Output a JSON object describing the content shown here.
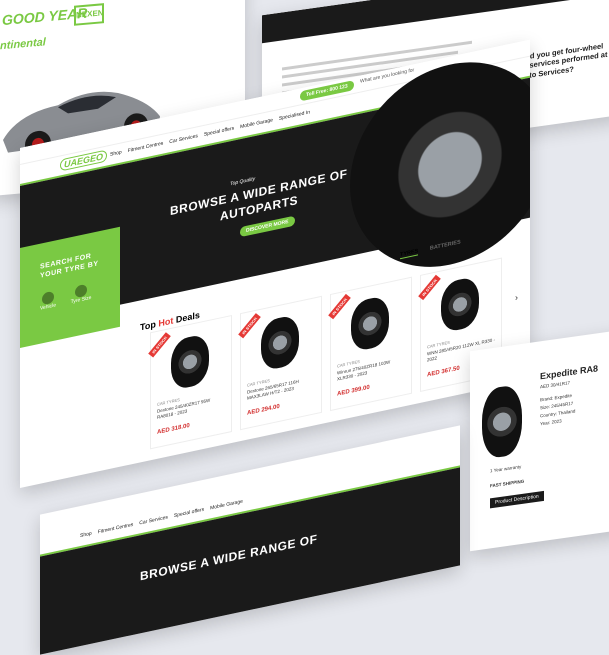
{
  "brands": {
    "goodyear": "GOOD YEAR",
    "continental": "ntinental",
    "nexen": "NEXEN"
  },
  "nav": {
    "logo": "UAEGEO",
    "items": [
      "Shop",
      "Fitment Centres",
      "Car Services",
      "Special offers",
      "Mobile Garage",
      "Specialised In"
    ],
    "search_placeholder": "What are you looking for",
    "phone": "Toll Free: 800 123"
  },
  "hero": {
    "tagline": "Top Quality",
    "title_line1": "BROWSE A WIDE RANGE OF",
    "title_line2": "AUTOPARTS",
    "cta": "DISCOVER MORE"
  },
  "search_panel": {
    "title_line1": "SEARCH FOR",
    "title_line2": "YOUR TYRE BY",
    "vehicle": "Vehicle",
    "tyre_size": "Tyre Size"
  },
  "tabs": {
    "tyres": "TYRES",
    "batteries": "BATTERIES"
  },
  "deals": {
    "heading_top": "Top",
    "heading_hot": "Hot",
    "heading_rest": "Deals",
    "products": [
      {
        "badge": "IN STOCK",
        "category": "CAR TYRES",
        "name": "Dextone 245/40ZR17 95W RA8018 - 2023",
        "price": "AED 318.00"
      },
      {
        "badge": "IN STOCK",
        "category": "CAR TYRES",
        "name": "Dextone 265/65R17 116H MAX3LAW H/T2 - 2023",
        "price": "AED 294.00"
      },
      {
        "badge": "IN STOCK",
        "category": "CAR TYRES",
        "name": "Winrun 275/40ZR18 103W XLR330 - 2023",
        "price": "AED 399.00"
      },
      {
        "badge": "IN STOCK",
        "category": "CAR TYRES",
        "name": "WNN 285/45R20 112W XL R330 - 2022",
        "price": "AED 367.50"
      }
    ]
  },
  "article": {
    "question_line1": "Why should you get four-wheel",
    "question_line2": "alignment services performed at",
    "question_line3": "Quality Auto Services?"
  },
  "product_detail": {
    "name": "Expedite RA8",
    "sku": "AED 30/41R17",
    "rows": [
      "Brand: Expedite",
      "Size: 245/45R17",
      "Country: Thailand",
      "Year: 2023"
    ],
    "tab": "Product Description",
    "shipping": "FAST SHIPPING",
    "warranty": "1 Year warranty"
  },
  "colors": {
    "brand_green": "#7ac943",
    "dark": "#1a1a1a",
    "price_red": "#d32f2f"
  }
}
